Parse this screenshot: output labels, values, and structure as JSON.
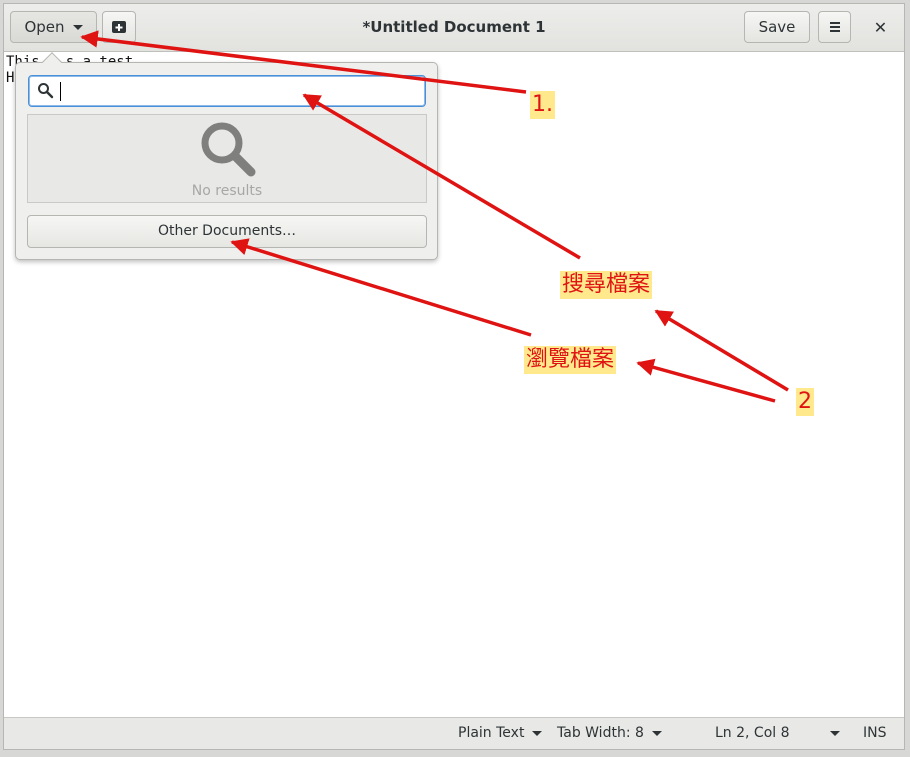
{
  "header": {
    "open_label": "Open",
    "title": "*Untitled Document 1",
    "save_label": "Save",
    "close_glyph": "✕",
    "icons": [
      "chevron-down-icon",
      "new-tab-icon",
      "hamburger-menu-icon",
      "close-icon"
    ]
  },
  "editor": {
    "line1_start": "This",
    "line1_end": "s a test",
    "line2": "H"
  },
  "popover": {
    "search_placeholder": "",
    "no_results": "No results",
    "other_documents": "Other Documents…"
  },
  "statusbar": {
    "language": "Plain Text",
    "tab_width": "Tab Width: 8",
    "position": "Ln 2, Col 8",
    "mode": "INS"
  },
  "annotations": {
    "step1": "1.",
    "search_files": "搜尋檔案",
    "browse_files": "瀏覽檔案",
    "step2": "2"
  },
  "colors": {
    "annotation_red": "#e01313",
    "annotation_highlight": "#ffe98c",
    "focus_blue": "#4a90d9"
  }
}
